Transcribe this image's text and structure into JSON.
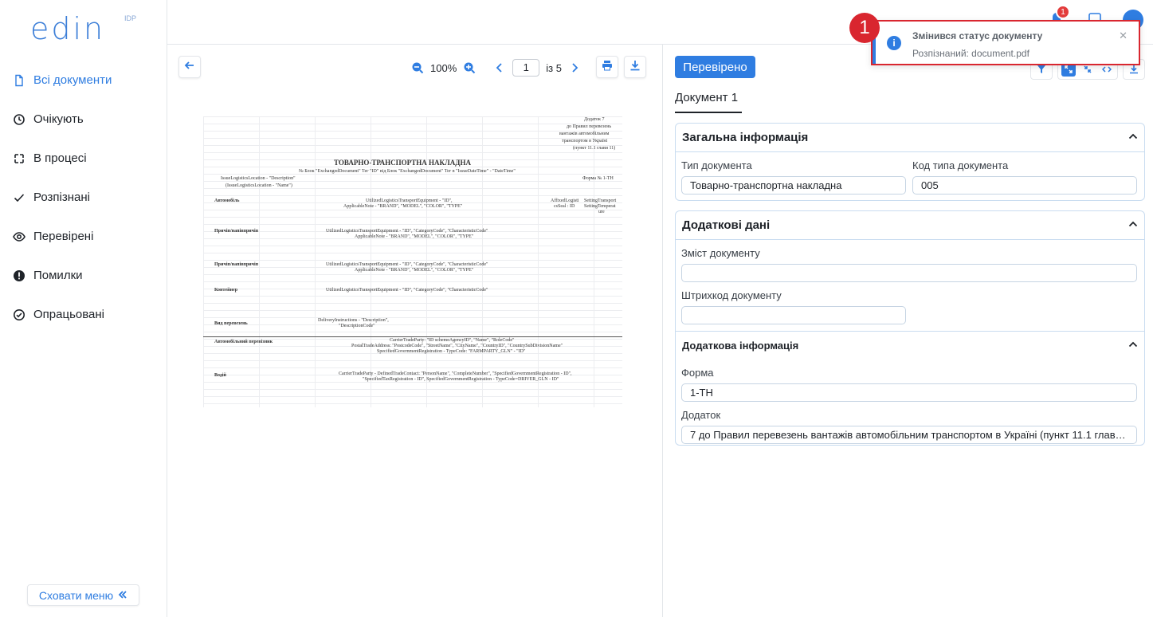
{
  "logo": {
    "text": "edin",
    "sup": "IDP"
  },
  "sidebar": {
    "items": [
      {
        "label": "Всі документи",
        "icon": "document-icon"
      },
      {
        "label": "Очікують",
        "icon": "clock-icon"
      },
      {
        "label": "В процесі",
        "icon": "process-icon"
      },
      {
        "label": "Розпізнані",
        "icon": "check-icon"
      },
      {
        "label": "Перевірені",
        "icon": "eye-icon"
      },
      {
        "label": "Помилки",
        "icon": "error-icon"
      },
      {
        "label": "Опрацьовані",
        "icon": "check-circle-icon"
      }
    ],
    "hide_label": "Сховати меню"
  },
  "topbar": {
    "badge_count": "1"
  },
  "viewer": {
    "zoom": "100%",
    "page": "1",
    "page_total": "із 5",
    "doc": {
      "annex": "Додаток 7",
      "annex2": "до Правил перевезень",
      "annex3": "вантажів автомобільним",
      "annex4": "транспортом в Україні",
      "annex5": "(пункт 11.1 глави 11)",
      "title": "ТОВАРНО-ТРАНСПОРТНА НАКЛАДНА",
      "line1": "№ Блок \"ExchangedDocument\" Тег \"ID\"     від Блок \"ExchangedDocument\" Тег в \"IssueDateTime\" - \"DateTime\"",
      "line2": "IssueLogisticsLocation - \"Description\"",
      "line2b": "Форма № 1-ТН",
      "line3": "(IssueLogisticsLocation - \"Name\")",
      "r1l": "Автомобіль",
      "r1c": "UtilizedLogisticsTransportEquipment - \"ID\",",
      "r1c2": "ApplicableNote - \"BRAND\", \"MODEL\", \"COLOR\", \"TYPE\"",
      "r1r": "AffixedLogisti",
      "r1r2": "csSeal : ID",
      "r1s": "SettingTransport",
      "r1s2": "SettingTemperat",
      "r1s3": "ure",
      "r2l": "Причіп/напівпричіп",
      "r2c": "UtilizedLogisticsTransportEquipment - \"ID\", \"CategoryCode\", \"CharacteristicCode\"",
      "r2c2": "ApplicableNote - \"BRAND\", \"MODEL\", \"COLOR\", \"TYPE\"",
      "r3l": "Причіп/напівпричіп",
      "r4l": "Контейнер",
      "r4c": "UtilizedLogisticsTransportEquipment - \"ID\", \"CategoryCode\", \"CharacteristicCode\"",
      "r5l": "Вид перевезень",
      "r5c": "DeliveryInstructions - \"Description\",",
      "r5c2": "\"DescriptionCode\"",
      "r6l": "Автомобільний перевізник",
      "r6c": "CarrierTradeParty: \"ID schemeAgencyID\", \"Name\", \"RoleCode\"",
      "r6c2": "PostalTradeAddress: \"PostcodeCode\", \"StreetName\", \"CityName\", \"CountryID\", \"CountrySubDivisionName\"",
      "r6c3": "SpecifiedGovernmentRegistration - TypeCode: \"FARMPARTY_GLN\" - \"ID\"",
      "r7l": "Водій",
      "r7c": "CarrierTradeParty - DefinedTradeContact: \"PersonName\", \"CompleteNumber\", \"SpecifiedGovernmentRegistration - ID\",",
      "r7c2": "\"SpecifiedTaxRegistration - ID\", SpecifiedGovernmentRegistration - TypeCode=DRIVER_GLN - ID\""
    }
  },
  "panel": {
    "status_button": "Перевірено",
    "tab": "Документ 1",
    "general": {
      "title": "Загальна інформація",
      "type_label": "Тип документа",
      "type_value": "Товарно-транспортна накладна",
      "code_label": "Код типа документа",
      "code_value": "005"
    },
    "extra": {
      "title": "Додаткові дані",
      "content_label": "Зміст документу",
      "content_value": "",
      "barcode_label": "Штрихкод документу",
      "barcode_value": "",
      "sub_title": "Додаткова інформація",
      "form_label": "Форма",
      "form_value": "1-ТН",
      "annex_label": "Додаток",
      "annex_value": "7 до Правил перевезень вантажів автомобільним транспортом в Україні (пункт 11.1 глави 1..."
    }
  },
  "toast": {
    "title": "Змінився статус документу",
    "message": "Розпізнаний: document.pdf",
    "marker": "1"
  },
  "colors": {
    "accent": "#2f7de1",
    "marker": "#d9262f",
    "card_border": "#c9dcf0"
  }
}
